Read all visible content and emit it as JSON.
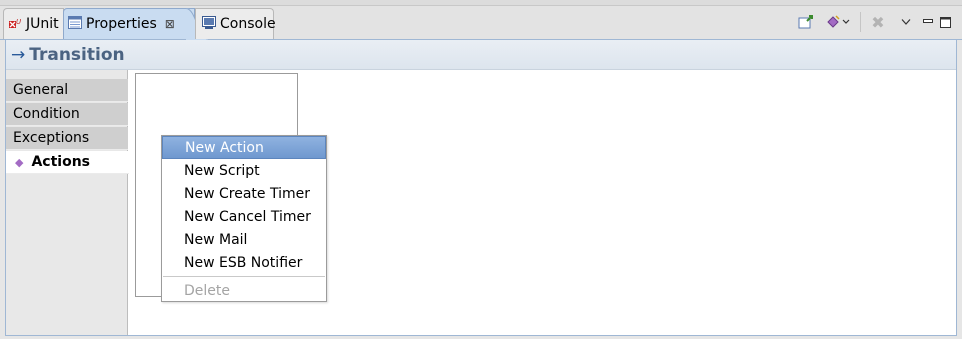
{
  "tabs": [
    {
      "label": "JUnit",
      "icon": "junit-icon"
    },
    {
      "label": "Properties",
      "icon": "properties-icon",
      "active": true
    },
    {
      "label": "Console",
      "icon": "console-icon"
    }
  ],
  "toolbar": {
    "pin_icon": "pin-editor-icon",
    "view_menu_icon": "view-menu-icon",
    "remove_icon": "remove-icon",
    "minimize_icon": "minimize-icon",
    "maximize_icon": "maximize-icon"
  },
  "header": {
    "arrow": "→",
    "title": "Transition"
  },
  "nav": [
    {
      "label": "General"
    },
    {
      "label": "Condition"
    },
    {
      "label": "Exceptions"
    },
    {
      "label": "Actions",
      "active": true
    }
  ],
  "context_menu": {
    "items": [
      {
        "label": "New Action",
        "highlighted": true
      },
      {
        "label": "New Script"
      },
      {
        "label": "New Create Timer"
      },
      {
        "label": "New Cancel Timer"
      },
      {
        "label": "New Mail"
      },
      {
        "label": "New ESB Notifier"
      }
    ],
    "disabled_item": "Delete"
  },
  "colors": {
    "accent": "#4b6382",
    "selection": "#7aa0d4",
    "tab_active": "#c9dcf1"
  }
}
